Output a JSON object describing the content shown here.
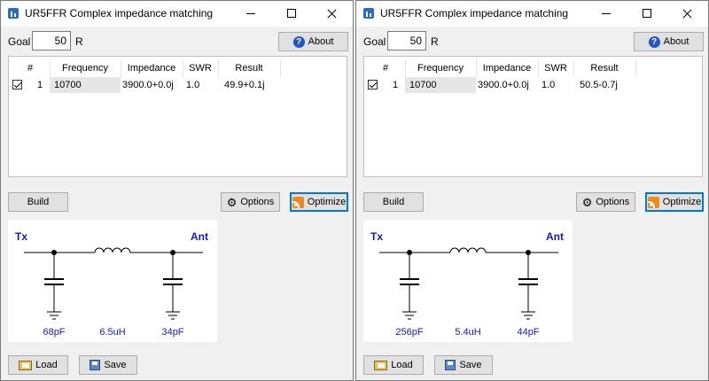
{
  "windows": [
    {
      "title": "UR5FFR Complex impedance matching",
      "goal_label": "Goal",
      "goal_value": "50",
      "goal_unit": "R",
      "about_label": "About",
      "table": {
        "headers": [
          "#",
          "Frequency",
          "Impedance",
          "SWR",
          "Result"
        ],
        "rows": [
          {
            "checked": true,
            "num": "1",
            "frequency": "10700",
            "impedance": "3900.0+0.0j",
            "swr": "1.0",
            "result": "49.9+0.1j"
          }
        ]
      },
      "build_label": "Build",
      "options_label": "Options",
      "optimize_label": "Optimize",
      "schematic": {
        "tx": "Tx",
        "ant": "Ant",
        "c1": "68pF",
        "l1": "6.5uH",
        "c2": "34pF"
      },
      "load_label": "Load",
      "save_label": "Save"
    },
    {
      "title": "UR5FFR Complex impedance matching",
      "goal_label": "Goal",
      "goal_value": "50",
      "goal_unit": "R",
      "about_label": "About",
      "table": {
        "headers": [
          "#",
          "Frequency",
          "Impedance",
          "SWR",
          "Result"
        ],
        "rows": [
          {
            "checked": true,
            "num": "1",
            "frequency": "10700",
            "impedance": "3900.0+0.0j",
            "swr": "1.0",
            "result": "50.5-0.7j"
          }
        ]
      },
      "build_label": "Build",
      "options_label": "Options",
      "optimize_label": "Optimize",
      "schematic": {
        "tx": "Tx",
        "ant": "Ant",
        "c1": "256pF",
        "l1": "5.4uH",
        "c2": "44pF"
      },
      "load_label": "Load",
      "save_label": "Save"
    }
  ],
  "colors": {
    "label_blue": "#1515d0",
    "focus_blue": "#0078d7",
    "accent_orange": "#f08a1c"
  }
}
